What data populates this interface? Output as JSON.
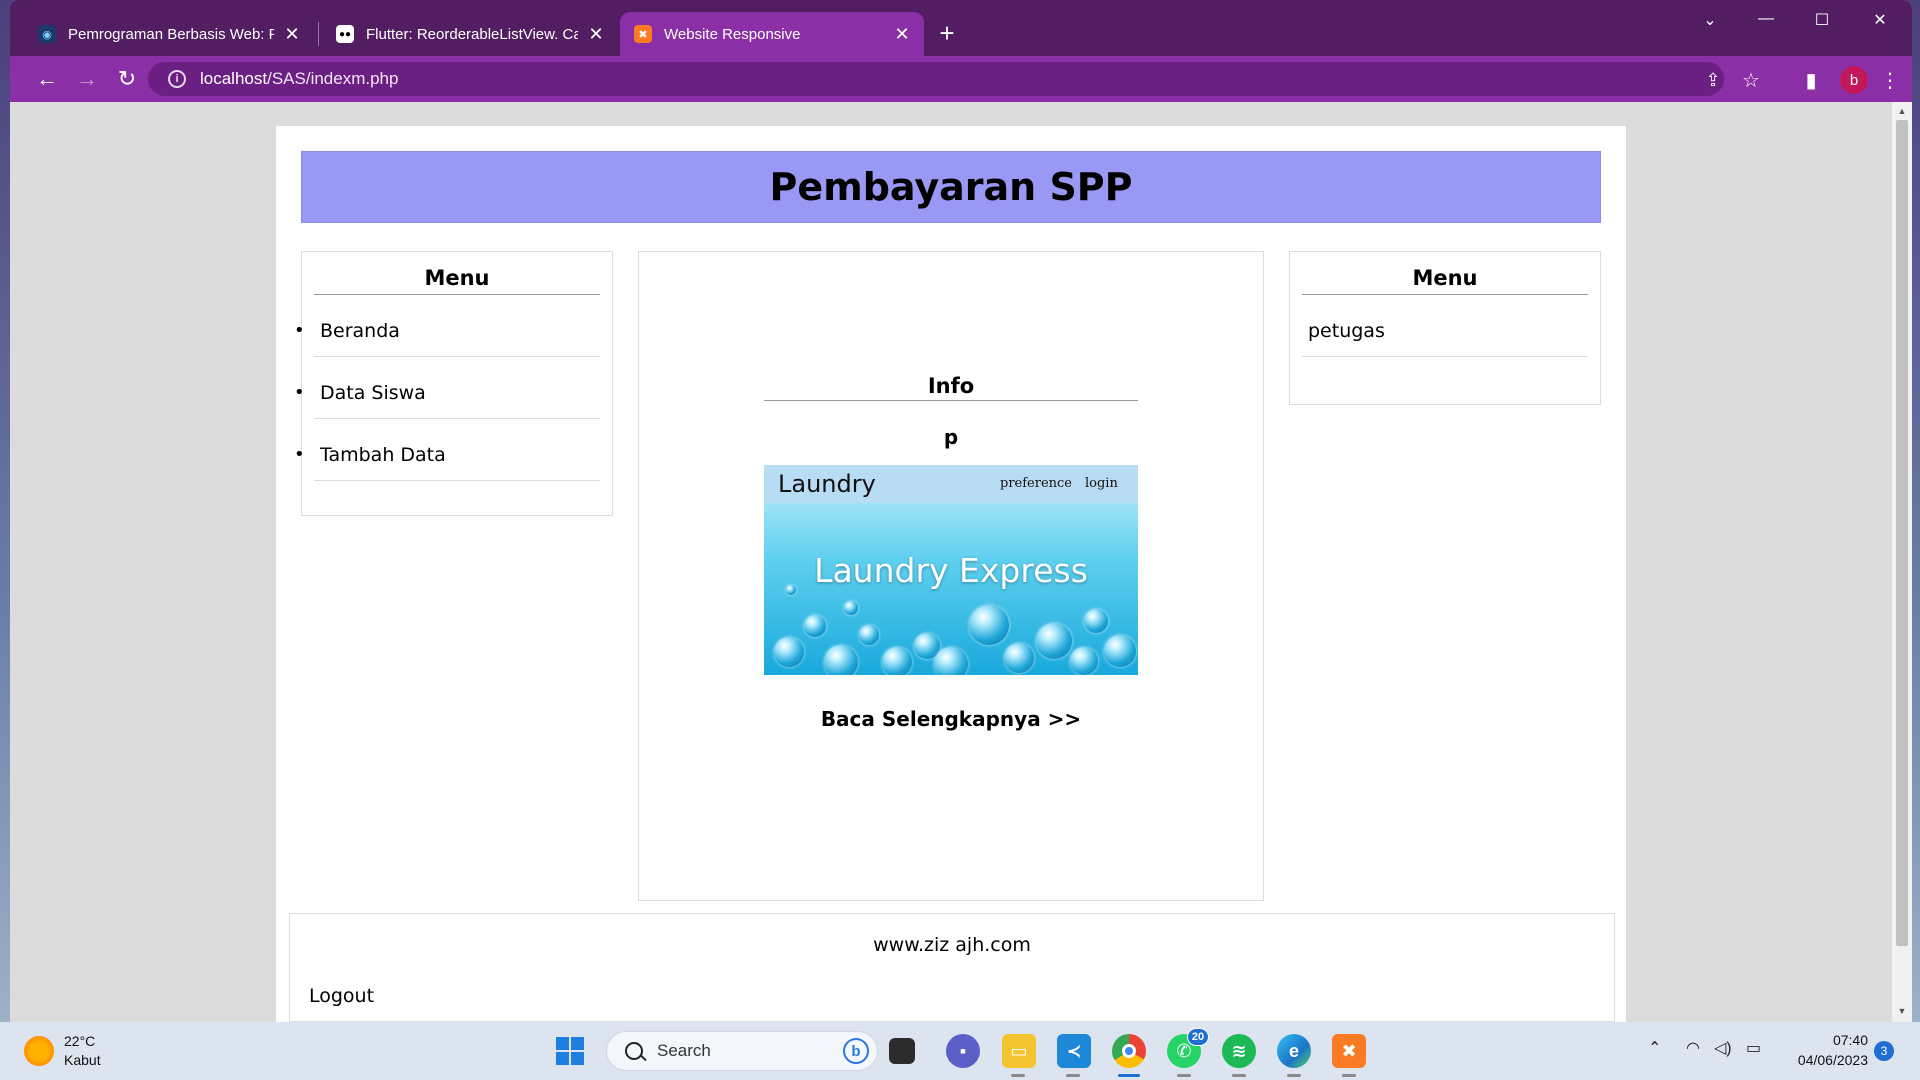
{
  "browser": {
    "tabs": [
      {
        "title": "Pemrograman Berbasis Web: Fur",
        "favicon": "globe-icon",
        "active": false
      },
      {
        "title": "Flutter: ReorderableListView. Car",
        "favicon": "medium-icon",
        "active": false
      },
      {
        "title": "Website Responsive",
        "favicon": "xampp-icon",
        "active": true
      }
    ],
    "new_tab_label": "+",
    "url_host": "localhost",
    "url_path": "/SAS/indexm.php",
    "profile_initial": "b",
    "colors": {
      "tabbar": "#531d62",
      "toolbar": "#8b2fa6"
    }
  },
  "page": {
    "header_title": "Pembayaran SPP",
    "left_menu": {
      "heading": "Menu",
      "items": [
        "Beranda",
        "Data Siswa",
        "Tambah Data"
      ]
    },
    "center": {
      "heading": "Info",
      "paragraph": "p",
      "laundry_image": {
        "brand": "Laundry",
        "links": [
          "preference",
          "login"
        ],
        "hero_text": "Laundry Express"
      },
      "read_more": "Baca Selengkapnya >>"
    },
    "right_menu": {
      "heading": "Menu",
      "items": [
        "petugas"
      ]
    },
    "footer": {
      "site": "www.ziz ajh.com",
      "logout": "Logout"
    },
    "colors": {
      "header_bg": "#9999f5"
    }
  },
  "taskbar": {
    "weather_temp": "22°C",
    "weather_desc": "Kabut",
    "search_label": "Search",
    "whatsapp_badge": "20",
    "time": "07:40",
    "date": "04/06/2023",
    "notification_count": "3"
  }
}
